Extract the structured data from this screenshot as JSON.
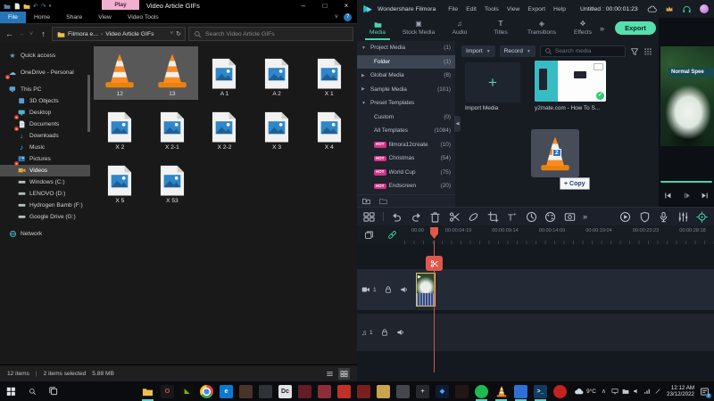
{
  "explorer": {
    "window_title": "Video Article GIFs",
    "contextual_group": "Play",
    "qat_icons": [
      "folder-icon",
      "page-icon",
      "new-folder-icon",
      "undo-icon",
      "redo-icon",
      "dropdown-icon"
    ],
    "ribbon_tabs": [
      {
        "label": "File",
        "active": true
      },
      {
        "label": "Home",
        "active": false
      },
      {
        "label": "Share",
        "active": false
      },
      {
        "label": "View",
        "active": false
      },
      {
        "label": "Video Tools",
        "active": false
      }
    ],
    "window_controls": {
      "minimize": "–",
      "maximize": "□",
      "close": "×"
    },
    "ribbon_collapse": "˅",
    "breadcrumb_root": "Filmora e...",
    "breadcrumb_sep": "›",
    "breadcrumb_current": "Video Article GIFs",
    "search_placeholder": "Search Video Article GIFs",
    "sidebar": [
      {
        "label": "Quick access",
        "icon": "star",
        "indent": 0,
        "badge": false,
        "selected": false,
        "gap": false
      },
      {
        "label": "OneDrive - Personal",
        "icon": "cloud",
        "indent": 0,
        "badge": true,
        "selected": false,
        "gap": true
      },
      {
        "label": "This PC",
        "icon": "pc",
        "indent": 0,
        "badge": false,
        "selected": false,
        "gap": true
      },
      {
        "label": "3D Objects",
        "icon": "box",
        "indent": 1,
        "badge": false,
        "selected": false,
        "gap": false
      },
      {
        "label": "Desktop",
        "icon": "desktop",
        "indent": 1,
        "badge": true,
        "selected": false,
        "gap": false
      },
      {
        "label": "Documents",
        "icon": "doc",
        "indent": 1,
        "badge": true,
        "selected": false,
        "gap": false
      },
      {
        "label": "Downloads",
        "icon": "down",
        "indent": 1,
        "badge": false,
        "selected": false,
        "gap": false
      },
      {
        "label": "Music",
        "icon": "music",
        "indent": 1,
        "badge": false,
        "selected": false,
        "gap": false
      },
      {
        "label": "Pictures",
        "icon": "pic",
        "indent": 1,
        "badge": true,
        "selected": false,
        "gap": false
      },
      {
        "label": "Videos",
        "icon": "video",
        "indent": 1,
        "badge": false,
        "selected": true,
        "gap": false
      },
      {
        "label": "Windows (C:)",
        "icon": "drive",
        "indent": 1,
        "badge": false,
        "selected": false,
        "gap": false
      },
      {
        "label": "LENOVO (D:)",
        "icon": "drive",
        "indent": 1,
        "badge": false,
        "selected": false,
        "gap": false
      },
      {
        "label": "Hydrogen Bamb (F:)",
        "icon": "drive",
        "indent": 1,
        "badge": false,
        "selected": false,
        "gap": false
      },
      {
        "label": "Google Drive (G:)",
        "icon": "drive",
        "indent": 1,
        "badge": false,
        "selected": false,
        "gap": false
      },
      {
        "label": "Network",
        "icon": "network",
        "indent": 0,
        "badge": false,
        "selected": false,
        "gap": true
      }
    ],
    "files": [
      {
        "name": "12",
        "type": "vlc",
        "selected": true
      },
      {
        "name": "13",
        "type": "vlc",
        "selected": true
      },
      {
        "name": "A 1",
        "type": "image",
        "selected": false
      },
      {
        "name": "A 2",
        "type": "image",
        "selected": false
      },
      {
        "name": "X 1",
        "type": "image",
        "selected": false
      },
      {
        "name": "X 2",
        "type": "image",
        "selected": false
      },
      {
        "name": "X 2-1",
        "type": "image",
        "selected": false
      },
      {
        "name": "X 2-2",
        "type": "image",
        "selected": false
      },
      {
        "name": "X 3",
        "type": "image",
        "selected": false
      },
      {
        "name": "X 4",
        "type": "image",
        "selected": false
      },
      {
        "name": "X 5",
        "type": "image",
        "selected": false
      },
      {
        "name": "X 53",
        "type": "image",
        "selected": false
      }
    ],
    "status_items": "12 items",
    "status_sep": "|",
    "status_selected": "2 items selected",
    "status_size": "5.88 MB"
  },
  "filmora": {
    "app_name": "Wondershare Filmora",
    "menus": [
      "File",
      "Edit",
      "Tools",
      "View",
      "Export",
      "Help"
    ],
    "doc_title": "Untitled : 00:00:01:23",
    "titlebar_icons": [
      "cloud-sync-icon",
      "upgrade-crown-icon",
      "support-headset-icon",
      "user-avatar"
    ],
    "tabs": [
      {
        "label": "Media",
        "icon": "folder",
        "active": true
      },
      {
        "label": "Stock Media",
        "icon": "stock",
        "active": false
      },
      {
        "label": "Audio",
        "icon": "audio",
        "active": false
      },
      {
        "label": "Titles",
        "icon": "titles",
        "active": false
      },
      {
        "label": "Transitions",
        "icon": "transitions",
        "active": false
      },
      {
        "label": "Effects",
        "icon": "effects",
        "active": false
      }
    ],
    "more_tabs_chevron": "»",
    "export_label": "Export",
    "media_sidebar": [
      {
        "label": "Project Media",
        "count": "(1)",
        "arrow": "down",
        "indent": 0,
        "selected": false,
        "hot": false
      },
      {
        "label": "Folder",
        "count": "(1)",
        "arrow": "",
        "indent": 1,
        "selected": true,
        "hot": false
      },
      {
        "label": "Global Media",
        "count": "(8)",
        "arrow": "right",
        "indent": 0,
        "selected": false,
        "hot": false
      },
      {
        "label": "Sample Media",
        "count": "(101)",
        "arrow": "right",
        "indent": 0,
        "selected": false,
        "hot": false
      },
      {
        "label": "Preset Templates",
        "count": "",
        "arrow": "down",
        "indent": 0,
        "selected": false,
        "hot": false
      },
      {
        "label": "Custom",
        "count": "(0)",
        "arrow": "",
        "indent": 1,
        "selected": false,
        "hot": false
      },
      {
        "label": "All Templates",
        "count": "(1084)",
        "arrow": "",
        "indent": 1,
        "selected": false,
        "hot": false
      },
      {
        "label": "filmora12create",
        "count": "(10)",
        "arrow": "",
        "indent": 1,
        "selected": false,
        "hot": true
      },
      {
        "label": "Christmas",
        "count": "(54)",
        "arrow": "",
        "indent": 1,
        "selected": false,
        "hot": true
      },
      {
        "label": "World Cup",
        "count": "(75)",
        "arrow": "",
        "indent": 1,
        "selected": false,
        "hot": true
      },
      {
        "label": "Endscreen",
        "count": "(20)",
        "arrow": "",
        "indent": 1,
        "selected": false,
        "hot": true
      }
    ],
    "hot_badge": "HOT",
    "import_dropdown": "Import",
    "record_dropdown": "Record",
    "media_search_placeholder": "Search media",
    "import_tile_plus": "+",
    "import_tile_label": "Import Media",
    "media_item_label": "y2mate.com - How To S...",
    "media_item_check": "✓",
    "drag_badge": "2",
    "drag_tooltip": "+ Copy",
    "preview_label": "Normal Spee",
    "timeline_tools_left": [
      "media-view",
      "divider",
      "undo",
      "redo",
      "delete",
      "split",
      "clip",
      "crop",
      "add-text",
      "speed",
      "color",
      "motion-track",
      "more"
    ],
    "timeline_tools_right": [
      "render-preview",
      "mask",
      "voiceover",
      "mixer",
      "keyframe"
    ],
    "ruler_icons": [
      "copy-tracks-icon",
      "link-tracks-icon"
    ],
    "ruler_ticks": [
      "00:00",
      "00:00:04:19",
      "00:00:09:14",
      "00:00:14:09",
      "00:00:19:04",
      "00:00:23:23",
      "00:00:28:18"
    ],
    "video_track_num": "1",
    "audio_track_num": "1"
  },
  "taskbar": {
    "start_icon": "windows-start-icon",
    "search_icon": "search-icon",
    "taskview_icon": "task-view-icon",
    "apps": [
      {
        "name": "file-explorer",
        "kind": "folder",
        "color": "#f0c04a",
        "glyph": "",
        "active": true
      },
      {
        "name": "opera-browser",
        "kind": "plain",
        "color": "#17181c",
        "glyph": "O",
        "textcolor": "#e04a3f",
        "active": false
      },
      {
        "name": "nvidia-app",
        "kind": "plain",
        "color": "#0e0e0e",
        "glyph": "◣",
        "textcolor": "#76b900",
        "active": false
      },
      {
        "name": "chrome-browser",
        "kind": "chrome",
        "color": "",
        "glyph": "",
        "active": false
      },
      {
        "name": "edge-blue-app",
        "kind": "plain",
        "color": "#0a7ad0",
        "glyph": "e",
        "textcolor": "#fff",
        "active": false
      },
      {
        "name": "photos-app",
        "kind": "plain",
        "color": "#4a3428",
        "glyph": "",
        "active": false
      },
      {
        "name": "dark-app",
        "kind": "plain",
        "color": "#30323a",
        "glyph": "",
        "active": false
      },
      {
        "name": "adobe-dc-app",
        "kind": "plain",
        "color": "#dfe2e6",
        "glyph": "Dc",
        "textcolor": "#222",
        "active": false
      },
      {
        "name": "adobe-app-1",
        "kind": "plain",
        "color": "#621d26",
        "glyph": "",
        "active": false
      },
      {
        "name": "adobe-app-2",
        "kind": "plain",
        "color": "#8c2e3a",
        "glyph": "",
        "active": false
      },
      {
        "name": "red-app",
        "kind": "plain",
        "color": "#c03028",
        "glyph": "",
        "active": false
      },
      {
        "name": "game-app-1",
        "kind": "plain",
        "color": "#7a1f1f",
        "glyph": "",
        "active": false
      },
      {
        "name": "game-app-2",
        "kind": "plain",
        "color": "#c9a34e",
        "glyph": "",
        "active": false
      },
      {
        "name": "gray-app",
        "kind": "plain",
        "color": "#44464e",
        "glyph": "",
        "active": false
      },
      {
        "name": "crosshair-app",
        "kind": "plain",
        "color": "#26282e",
        "glyph": "+",
        "textcolor": "#c8c8c8",
        "active": false
      },
      {
        "name": "vanguard-app",
        "kind": "plain",
        "color": "#0f1b33",
        "glyph": "◆",
        "textcolor": "#5aa0f0",
        "active": false
      },
      {
        "name": "claw-app",
        "kind": "plain",
        "color": "#241616",
        "glyph": "",
        "active": false
      },
      {
        "name": "spotify",
        "kind": "plain",
        "color": "#1db954",
        "glyph": "",
        "round": true,
        "active": true
      },
      {
        "name": "vlc-player",
        "kind": "vlc",
        "color": "",
        "glyph": "",
        "active": true
      },
      {
        "name": "blue-app",
        "kind": "plain",
        "color": "#2f6fd8",
        "glyph": "",
        "active": true
      },
      {
        "name": "powershell",
        "kind": "plain",
        "color": "#123a5e",
        "glyph": ">_",
        "textcolor": "#cfe8ff",
        "active": true
      },
      {
        "name": "security-app",
        "kind": "plain",
        "color": "#c22222",
        "glyph": "",
        "round": true,
        "active": false
      }
    ],
    "temp": "9°C",
    "caret": "∧",
    "tray_icons": [
      "monitor-icon",
      "folder-icon",
      "speaker-icon",
      "network-icon",
      "pen-icon"
    ],
    "time": "12:12 AM",
    "date": "23/12/2022",
    "notif_badge": "2"
  },
  "colors": {
    "accent_teal": "#4bd6ab",
    "export_button": "#55e0ae",
    "hot_badge": "#d6308a",
    "playhead_red": "#e0584a",
    "file_tab_blue": "#2576b9",
    "play_tab_pink": "#f2afcf",
    "selection_gray": "#585858",
    "clip_border_yellow": "#d8c35a"
  }
}
